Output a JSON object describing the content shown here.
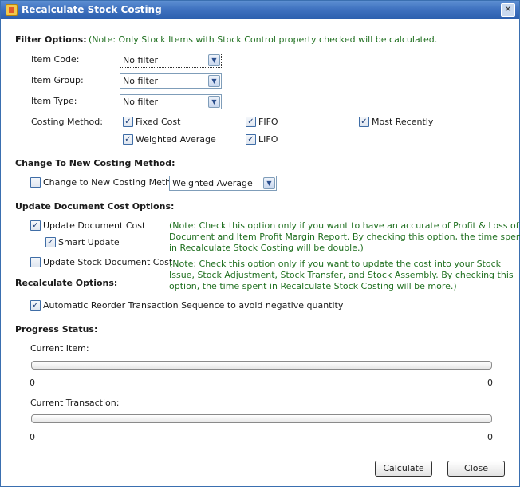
{
  "window": {
    "title": "Recalculate Stock Costing",
    "close_glyph": "✕"
  },
  "filter": {
    "heading": "Filter Options:",
    "note": "(Note: Only Stock Items with Stock Control property checked will be calculated.",
    "item_code_label": "Item Code:",
    "item_code_value": "No filter",
    "item_group_label": "Item Group:",
    "item_group_value": "No filter",
    "item_type_label": "Item Type:",
    "item_type_value": "No filter",
    "costing_method_label": "Costing Method:",
    "methods": {
      "fixed_cost": "Fixed Cost",
      "fifo": "FIFO",
      "most_recently": "Most Recently",
      "weighted_average": "Weighted Average",
      "lifo": "LIFO"
    }
  },
  "change": {
    "heading": "Change To New Costing Method:",
    "checkbox_label": "Change to New Costing Method",
    "method_value": "Weighted Average"
  },
  "update_doc": {
    "heading": "Update Document Cost Options:",
    "update_cost_label": "Update Document Cost",
    "note1_line1": "(Note: Check this option only if you want to have an accurate of Profit & Loss of",
    "note1_line2": "Document and Item Profit Margin Report. By checking this option, the time spent",
    "note1_line3": "in Recalculate Stock Costing will be double.)",
    "smart_update_label": "Smart Update",
    "update_stock_label": "Update Stock Document Cost",
    "note2_line1": "(Note: Check this option only if you want to update the cost into your Stock",
    "note2_line2": "Issue, Stock Adjustment, Stock Transfer, and Stock Assembly. By checking this",
    "note2_line3": "option, the time spent in Recalculate Stock Costing will be more.)"
  },
  "recalc": {
    "heading": "Recalculate Options:",
    "auto_reorder_label": "Automatic Reorder Transaction Sequence to avoid negative quantity"
  },
  "progress": {
    "heading": "Progress Status:",
    "current_item_label": "Current Item:",
    "current_item_min": "0",
    "current_item_max": "0",
    "current_transaction_label": "Current Transaction:",
    "current_transaction_min": "0",
    "current_transaction_max": "0"
  },
  "buttons": {
    "calculate": "Calculate",
    "close": "Close"
  },
  "icons": {
    "check": "✓",
    "dropdown": "▼"
  }
}
